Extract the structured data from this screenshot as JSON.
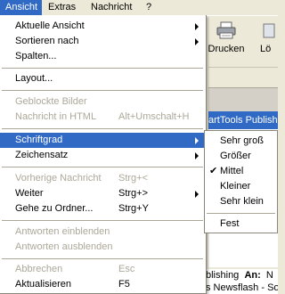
{
  "menubar": {
    "items": [
      "Ansicht",
      "Extras",
      "Nachricht",
      "?"
    ]
  },
  "toolbar": {
    "print_label": "Drucken",
    "delete_label_partial": "Lö"
  },
  "list": {
    "header_partial": "artTools Publishi"
  },
  "preview": {
    "line1_a": "blishing",
    "line1_b": "An:",
    "line1_c": "N",
    "line2": "s Newsflash - So"
  },
  "menu": {
    "aktuelle_ansicht": "Aktuelle Ansicht",
    "sortieren_nach": "Sortieren nach",
    "spalten": "Spalten...",
    "layout": "Layout...",
    "geblockte_bilder": "Geblockte Bilder",
    "nachricht_in_html": "Nachricht in HTML",
    "nachricht_in_html_shortcut": "Alt+Umschalt+H",
    "schriftgrad": "Schriftgrad",
    "zeichensatz": "Zeichensatz",
    "vorherige_nachricht": "Vorherige Nachricht",
    "vorherige_nachricht_shortcut": "Strg+<",
    "weiter": "Weiter",
    "weiter_shortcut": "Strg+>",
    "gehe_zu_ordner": "Gehe zu Ordner...",
    "gehe_zu_ordner_shortcut": "Strg+Y",
    "antworten_einblenden": "Antworten einblenden",
    "antworten_ausblenden": "Antworten ausblenden",
    "abbrechen": "Abbrechen",
    "abbrechen_shortcut": "Esc",
    "aktualisieren": "Aktualisieren",
    "aktualisieren_shortcut": "F5"
  },
  "submenu": {
    "items": [
      "Sehr groß",
      "Größer",
      "Mittel",
      "Kleiner",
      "Sehr klein"
    ],
    "checked": "Mittel",
    "fest": "Fest"
  },
  "colors": {
    "highlight": "#316ac5",
    "menu_face": "#ece9d8",
    "disabled_text": "#aca899"
  }
}
